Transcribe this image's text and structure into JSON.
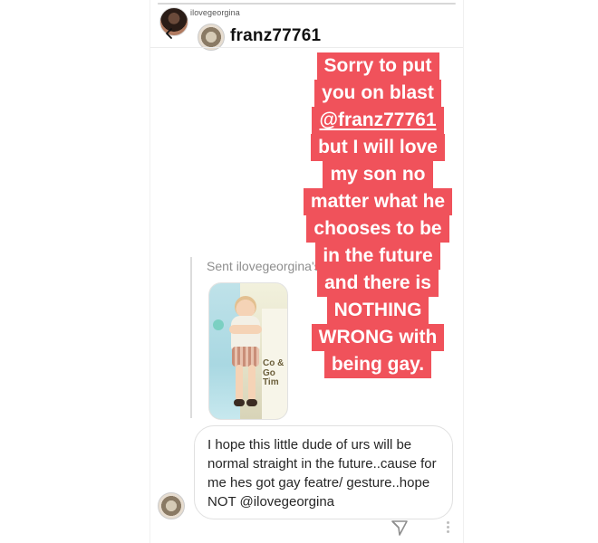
{
  "story": {
    "progress": 0.12,
    "username": "ilovegeorgina",
    "username_suffix": " "
  },
  "dm": {
    "username": "franz77761",
    "back_icon": "back-arrow-icon"
  },
  "overlay": {
    "lines": [
      "Sorry to put",
      "you on blast",
      "@franz77761",
      "but I will love",
      "my son no",
      "matter what he",
      "chooses to be",
      "in the future",
      "and there is",
      "NOTHING",
      "WRONG with",
      "being gay."
    ],
    "background_color": "#f0525b",
    "text_color": "#ffffff"
  },
  "sent": {
    "label": "Sent ilovegeorgina's"
  },
  "photo": {
    "poster_text": "Co & Go Tim"
  },
  "message": {
    "text": "I hope this little dude of urs will be normal straight in the future..cause for me hes got gay featre/ gesture..hope NOT @ilovegeorgina"
  },
  "footer": {
    "send_icon": "send-icon",
    "more_icon": "more-dots-icon"
  }
}
